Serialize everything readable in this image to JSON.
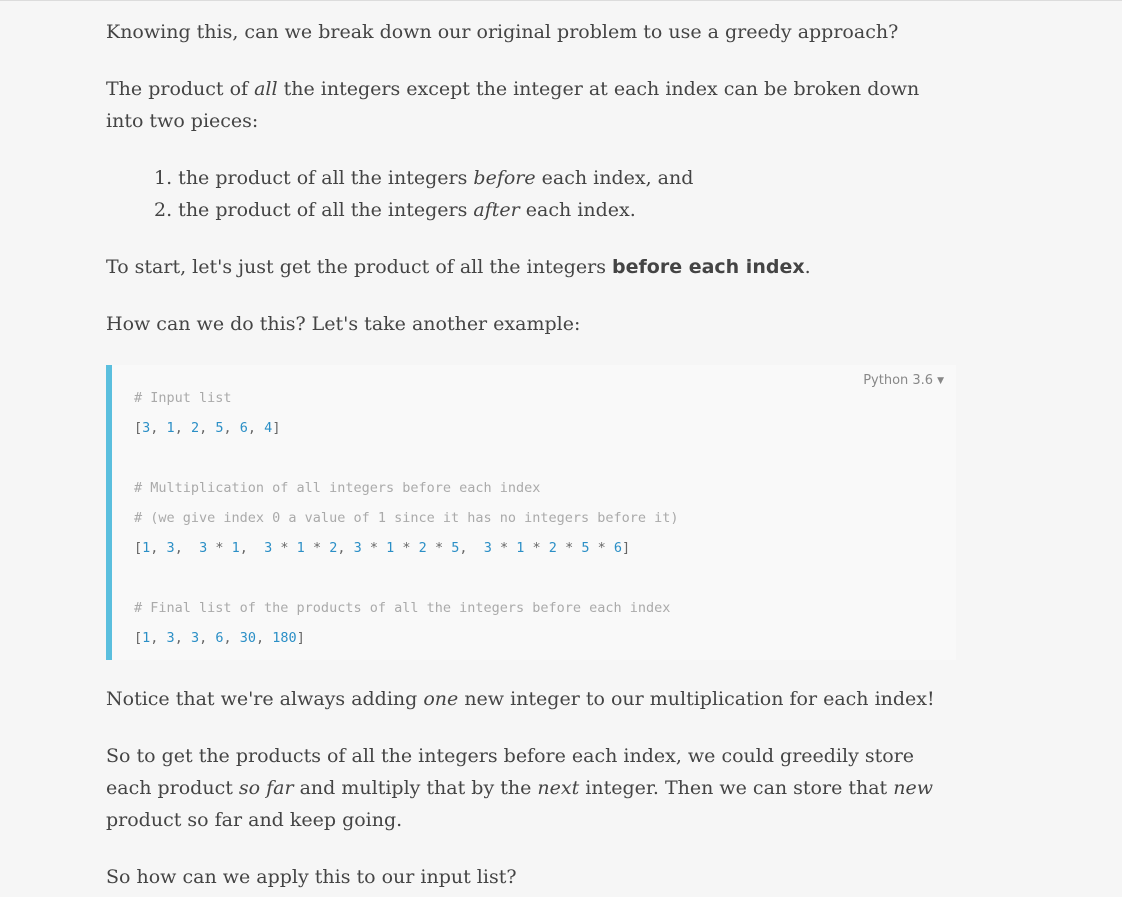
{
  "para1": "Knowing this, can we break down our original problem to use a greedy approach?",
  "para2": {
    "a": "The product of ",
    "em": "all",
    "b": " the integers except the integer at each index can be broken down into two pieces:"
  },
  "list": [
    {
      "num": "1.",
      "a": " the product of all the integers ",
      "em": "before",
      "b": " each index, and"
    },
    {
      "num": "2.",
      "a": " the product of all the integers ",
      "em": "after",
      "b": " each index."
    }
  ],
  "para3": {
    "a": "To start, let's just get the product of all the integers ",
    "strong": "before each index",
    "b": "."
  },
  "para4": "How can we do this? Let's take another example:",
  "code": {
    "language": "Python 3.6",
    "comment1": "# Input list",
    "list1": [
      "3",
      "1",
      "2",
      "5",
      "6",
      "4"
    ],
    "comment2": "# Multiplication of all integers before each index",
    "comment3": "# (we give index 0 a value of 1 since it has no integers before it)",
    "comment4": "# Final list of the products of all the integers before each index",
    "list3": [
      "1",
      "3",
      "3",
      "6",
      "30",
      "180"
    ]
  },
  "para5": {
    "a": "Notice that we're always adding ",
    "em": "one",
    "b": " new integer to our multiplication for each index!"
  },
  "para6": {
    "a": "So to get the products of all the integers before each index, we could greedily store each product ",
    "em1": "so far",
    "b": " and multiply that by the ",
    "em2": "next",
    "c": " integer. Then we can store that ",
    "em3": "new",
    "d": " product so far and keep going."
  },
  "para7": "So how can we apply this to our input list?"
}
